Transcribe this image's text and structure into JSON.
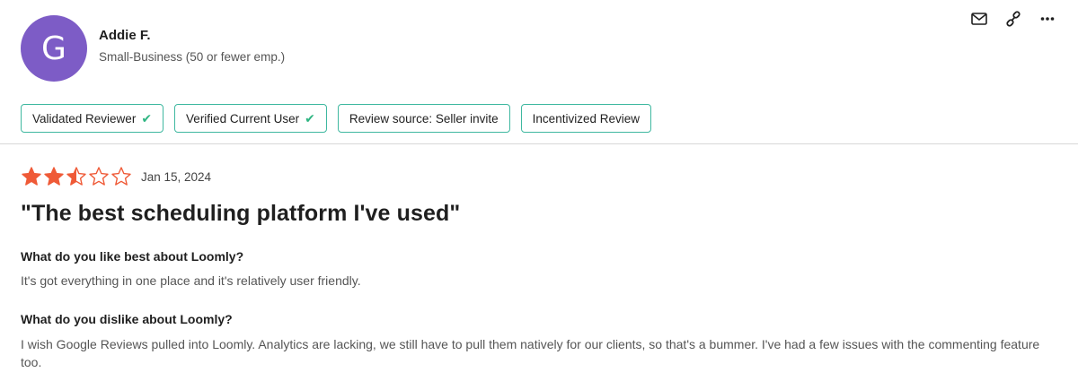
{
  "reviewer": {
    "avatar_initial": "G",
    "avatar_color": "#7d5cc6",
    "name": "Addie F.",
    "segment": "Small-Business (50 or fewer emp.)"
  },
  "actions": [
    {
      "icon": "mail-icon"
    },
    {
      "icon": "link-icon"
    },
    {
      "icon": "more-icon"
    }
  ],
  "badges": [
    {
      "label": "Validated Reviewer",
      "check": "✔"
    },
    {
      "label": "Verified Current User",
      "check": "✔"
    },
    {
      "label": "Review source: Seller invite"
    },
    {
      "label": "Incentivized Review"
    }
  ],
  "review": {
    "rating": 2.5,
    "rating_max": 5,
    "star_color": "#ef5a37",
    "date": "Jan 15, 2024",
    "title": "\"The best scheduling platform I've used\"",
    "q1": "What do you like best about Loomly?",
    "a1": "It's got everything in one place and it's relatively user friendly.",
    "q2": "What do you dislike about Loomly?",
    "a2": "I wish Google Reviews pulled into Loomly. Analytics are lacking, we still have to pull them natively for our clients, so that's a bummer. I've had a few issues with the commenting feature too."
  }
}
